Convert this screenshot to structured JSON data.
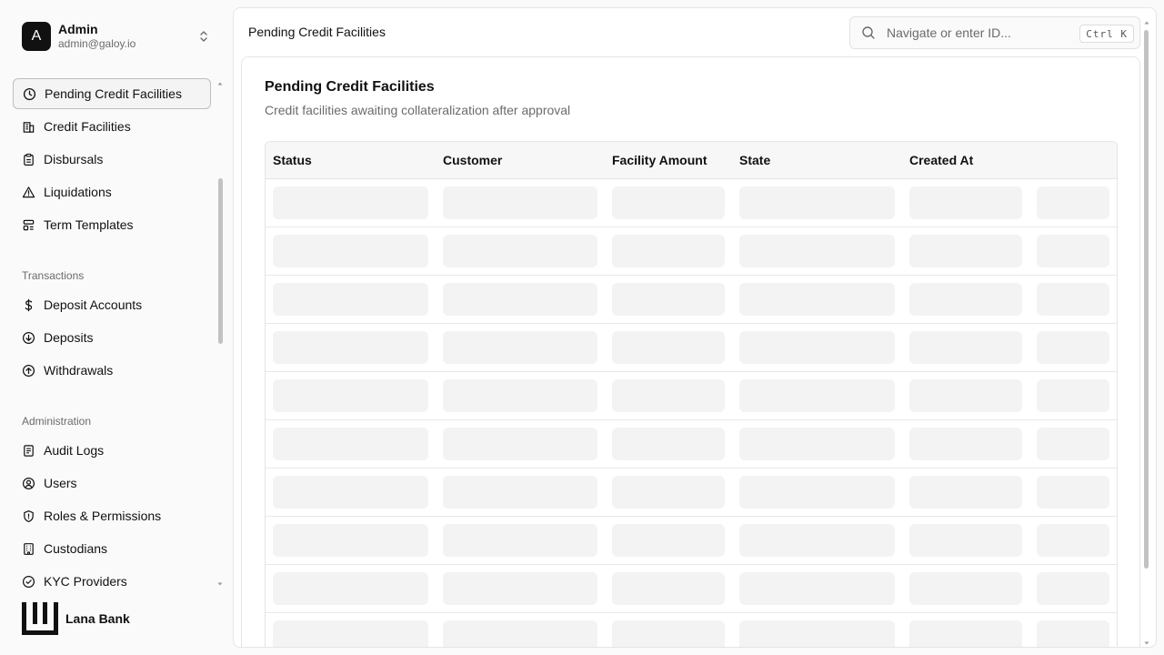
{
  "account": {
    "initial": "A",
    "name": "Admin",
    "email": "admin@galoy.io"
  },
  "sidebar": {
    "items": [
      {
        "label": "Pending Credit Facilities",
        "icon": "clock-icon",
        "active": true
      },
      {
        "label": "Credit Facilities",
        "icon": "bank-icon"
      },
      {
        "label": "Disbursals",
        "icon": "clipboard-icon"
      },
      {
        "label": "Liquidations",
        "icon": "warning-triangle-icon"
      },
      {
        "label": "Term Templates",
        "icon": "template-icon"
      }
    ],
    "transactions": {
      "title": "Transactions",
      "items": [
        {
          "label": "Deposit Accounts",
          "icon": "dollar-icon"
        },
        {
          "label": "Deposits",
          "icon": "arrow-down-circle-icon"
        },
        {
          "label": "Withdrawals",
          "icon": "arrow-up-circle-icon"
        }
      ]
    },
    "administration": {
      "title": "Administration",
      "items": [
        {
          "label": "Audit Logs",
          "icon": "document-icon"
        },
        {
          "label": "Users",
          "icon": "user-circle-icon"
        },
        {
          "label": "Roles & Permissions",
          "icon": "shield-icon"
        },
        {
          "label": "Custodians",
          "icon": "building-icon"
        },
        {
          "label": "KYC Providers",
          "icon": "check-circle-icon"
        }
      ]
    }
  },
  "brand": {
    "name": "Lana Bank"
  },
  "topbar": {
    "title": "Pending Credit Facilities",
    "search_placeholder": "Navigate or enter ID...",
    "shortcut": "Ctrl K"
  },
  "card": {
    "title": "Pending Credit Facilities",
    "description": "Credit facilities awaiting collateralization after approval"
  },
  "table": {
    "columns": [
      "Status",
      "Customer",
      "Facility Amount",
      "State",
      "Created At"
    ],
    "loading_rows": 10
  },
  "colors": {
    "accent": "#111111",
    "muted_text": "#6b6b6b",
    "skeleton": "#f3f3f3",
    "border": "#e5e5e5"
  }
}
